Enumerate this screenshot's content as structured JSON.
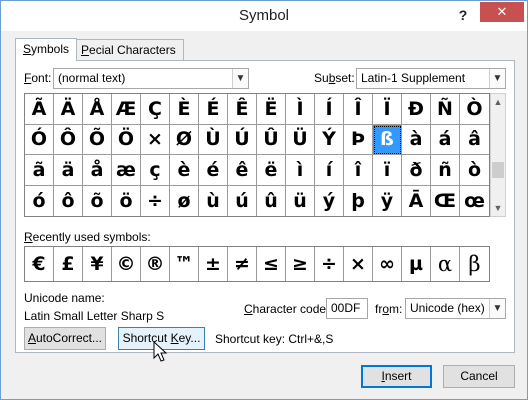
{
  "window": {
    "title": "Symbol",
    "help_glyph": "?",
    "close_glyph": "✕"
  },
  "tabs": [
    {
      "label_pre": "",
      "label_u": "S",
      "label_post": "ymbols"
    },
    {
      "label_pre": "",
      "label_u": "P",
      "label_post": "ecial Characters"
    }
  ],
  "font": {
    "label_pre": "",
    "label_u": "F",
    "label_post": "ont:",
    "value": "(normal text)"
  },
  "subset": {
    "label_pre": "Su",
    "label_u": "b",
    "label_post": "set:",
    "value": "Latin-1 Supplement"
  },
  "symbols": [
    "Ã",
    "Ä",
    "Å",
    "Æ",
    "Ç",
    "È",
    "É",
    "Ê",
    "Ë",
    "Ì",
    "Í",
    "Î",
    "Ï",
    "Ð",
    "Ñ",
    "Ò",
    "Ó",
    "Ô",
    "Õ",
    "Ö",
    "×",
    "Ø",
    "Ù",
    "Ú",
    "Û",
    "Ü",
    "Ý",
    "Þ",
    "ß",
    "à",
    "á",
    "â",
    "ã",
    "ä",
    "å",
    "æ",
    "ç",
    "è",
    "é",
    "ê",
    "ë",
    "ì",
    "í",
    "î",
    "ï",
    "ð",
    "ñ",
    "ò",
    "ó",
    "ô",
    "õ",
    "ö",
    "÷",
    "ø",
    "ù",
    "ú",
    "û",
    "ü",
    "ý",
    "þ",
    "ÿ",
    "Ā",
    "Œ",
    "œ"
  ],
  "selected_index": 28,
  "recent": {
    "label_pre": "",
    "label_u": "R",
    "label_post": "ecently used symbols:",
    "items": [
      "€",
      "£",
      "¥",
      "©",
      "®",
      "™",
      "±",
      "≠",
      "≤",
      "≥",
      "÷",
      "×",
      "∞",
      "µ",
      "α",
      "β"
    ]
  },
  "unicode_name": {
    "label": "Unicode name:",
    "value": "Latin Small Letter Sharp S"
  },
  "character_code": {
    "label_pre": "",
    "label_u": "C",
    "label_post": "haracter code:",
    "value": "00DF"
  },
  "from": {
    "label_pre": "fr",
    "label_u": "o",
    "label_post": "m:",
    "value": "Unicode (hex)"
  },
  "buttons": {
    "autocorrect": {
      "pre": "",
      "u": "A",
      "post": "utoCorrect..."
    },
    "shortcut_key": {
      "pre": "Shortcut ",
      "u": "K",
      "post": "ey..."
    },
    "insert": {
      "pre": "",
      "u": "I",
      "post": "nsert"
    },
    "cancel": "Cancel"
  },
  "shortcut_key_text": "Shortcut key: Ctrl+&,S"
}
